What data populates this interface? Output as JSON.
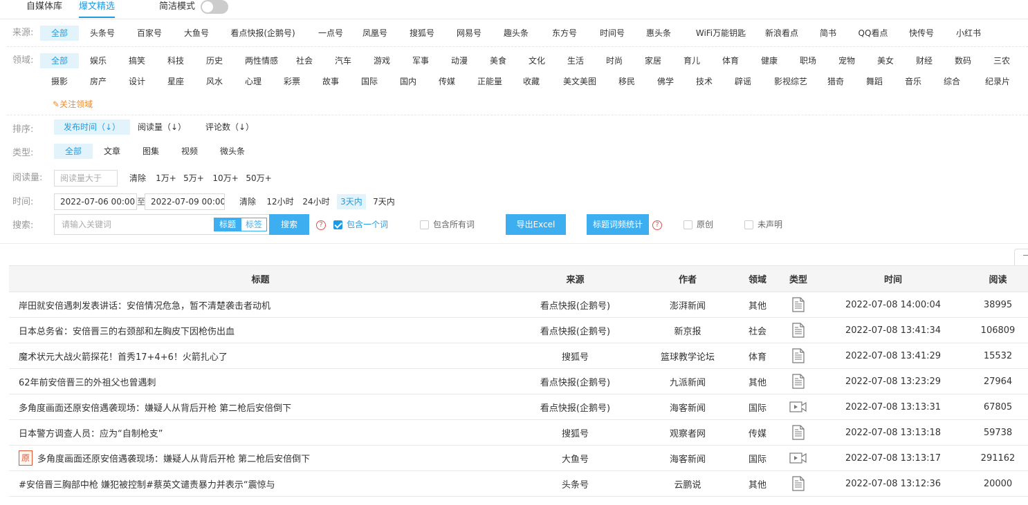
{
  "top_tabs": [
    {
      "label": "自媒体库",
      "active": false
    },
    {
      "label": "爆文精选",
      "active": true
    }
  ],
  "simple_mode_label": "简洁模式",
  "source": {
    "label": "来源:",
    "options": [
      "全部",
      "头条号",
      "百家号",
      "大鱼号",
      "看点快报(企鹅号)",
      "一点号",
      "凤凰号",
      "搜狐号",
      "网易号",
      "趣头条",
      "东方号",
      "时间号",
      "惠头条",
      "WiFi万能钥匙",
      "新浪看点",
      "简书",
      "QQ看点",
      "快传号",
      "小红书"
    ]
  },
  "domain": {
    "label": "领域:",
    "row1": [
      "全部",
      "娱乐",
      "搞笑",
      "科技",
      "历史",
      "两性情感",
      "社会",
      "汽车",
      "游戏",
      "军事",
      "动漫",
      "美食",
      "文化",
      "生活",
      "时尚",
      "家居",
      "育儿",
      "体育",
      "健康",
      "职场",
      "宠物",
      "美女",
      "财经",
      "数码",
      "三农"
    ],
    "row2": [
      "摄影",
      "房产",
      "设计",
      "星座",
      "风水",
      "心理",
      "彩票",
      "故事",
      "国际",
      "国内",
      "传媒",
      "正能量",
      "收藏",
      "美文美图",
      "移民",
      "佛学",
      "技术",
      "辟谣",
      "影视综艺",
      "猎奇",
      "舞蹈",
      "音乐",
      "综合",
      "纪录片"
    ],
    "focus_link": "关注领域"
  },
  "sort": {
    "label": "排序:",
    "options": [
      "发布时间（↓）",
      "阅读量（↓）",
      "评论数（↓）"
    ]
  },
  "type": {
    "label": "类型:",
    "options": [
      "全部",
      "文章",
      "图集",
      "视频",
      "微头条"
    ]
  },
  "reads": {
    "label": "阅读量:",
    "placeholder": "阅读量大于",
    "clear": "清除",
    "options": [
      "1万+",
      "5万+",
      "10万+",
      "50万+"
    ]
  },
  "time": {
    "label": "时间:",
    "start": "2022-07-06 00:00",
    "to": "至",
    "end": "2022-07-09 00:00",
    "clear": "清除",
    "options": [
      "12小时",
      "24小时",
      "3天内",
      "7天内"
    ]
  },
  "search": {
    "label": "搜索:",
    "placeholder": "请输入关键词",
    "seg_title": "标题",
    "seg_tag": "标签",
    "button": "搜索",
    "contains_one": "包含一个词",
    "contains_all": "包含所有词",
    "export": "导出Excel",
    "word_freq": "标题词频统计",
    "original": "原创",
    "undeclared": "未声明",
    "help": "?"
  },
  "table": {
    "headers": [
      "标题",
      "来源",
      "作者",
      "领域",
      "类型",
      "时间",
      "阅读"
    ],
    "orig_badge": "原",
    "rows": [
      {
        "title": "岸田就安倍遇刺发表讲话：安倍情况危急，暂不清楚袭击者动机",
        "source": "看点快报(企鹅号)",
        "author": "澎湃新闻",
        "domain": "其他",
        "type": "article",
        "time": "2022-07-08 14:00:04",
        "reads": "38995",
        "original": false
      },
      {
        "title": "日本总务省：安倍晋三的右颈部和左胸皮下因枪伤出血",
        "source": "看点快报(企鹅号)",
        "author": "新京报",
        "domain": "社会",
        "type": "article",
        "time": "2022-07-08 13:41:34",
        "reads": "106809",
        "original": false
      },
      {
        "title": "魔术状元大战火箭探花！首秀17+4+6！火箭扎心了",
        "source": "搜狐号",
        "author": "篮球教学论坛",
        "domain": "体育",
        "type": "article",
        "time": "2022-07-08 13:41:29",
        "reads": "15532",
        "original": false
      },
      {
        "title": "62年前安倍晋三的外祖父也曾遇刺",
        "source": "看点快报(企鹅号)",
        "author": "九派新闻",
        "domain": "其他",
        "type": "article",
        "time": "2022-07-08 13:23:29",
        "reads": "27964",
        "original": false
      },
      {
        "title": "多角度画面还原安倍遇袭现场：嫌疑人从背后开枪 第二枪后安倍倒下",
        "source": "看点快报(企鹅号)",
        "author": "海客新闻",
        "domain": "国际",
        "type": "video",
        "time": "2022-07-08 13:13:31",
        "reads": "67805",
        "original": false
      },
      {
        "title": "日本警方调查人员：应为“自制枪支”",
        "source": "搜狐号",
        "author": "观察者网",
        "domain": "传媒",
        "type": "article",
        "time": "2022-07-08 13:13:18",
        "reads": "59738",
        "original": false
      },
      {
        "title": "多角度画面还原安倍遇袭现场：嫌疑人从背后开枪 第二枪后安倍倒下",
        "source": "大鱼号",
        "author": "海客新闻",
        "domain": "国际",
        "type": "video",
        "time": "2022-07-08 13:13:17",
        "reads": "291162",
        "original": true
      },
      {
        "title": "#安倍晋三胸部中枪 嫌犯被控制#蔡英文谴责暴力并表示“震惊与",
        "source": "头条号",
        "author": "云鹏说",
        "domain": "其他",
        "type": "article",
        "time": "2022-07-08 13:12:36",
        "reads": "20000",
        "original": false
      }
    ]
  }
}
